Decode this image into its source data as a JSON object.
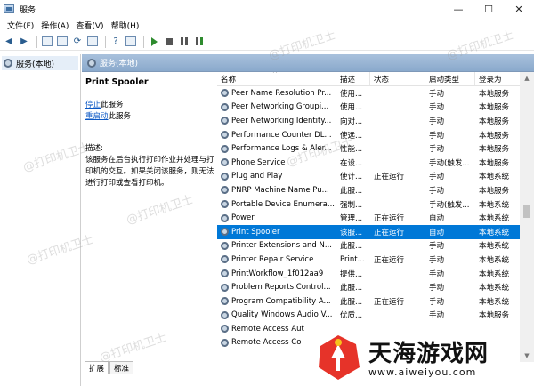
{
  "window": {
    "title": "服务",
    "controls": [
      "—",
      "☐",
      "✕"
    ]
  },
  "menu": [
    "文件(F)",
    "操作(A)",
    "查看(V)",
    "帮助(H)"
  ],
  "tree": {
    "root_label": "服务(本地)"
  },
  "pane": {
    "header": "服务(本地)"
  },
  "details": {
    "service_name": "Print Spooler",
    "stop_link": "停止",
    "stop_suffix": "此服务",
    "restart_link": "重启动",
    "restart_suffix": "此服务",
    "desc_label": "描述:",
    "desc_text": "该服务在后台执行打印作业并处理与打印机的交互。如果关闭该服务，则无法进行打印或查看打印机。"
  },
  "columns": {
    "name": "名称",
    "desc": "描述",
    "status": "状态",
    "startup": "启动类型",
    "login": "登录为"
  },
  "rows": [
    {
      "name": "Peer Name Resolution Pr...",
      "desc": "使用...",
      "status": "",
      "startup": "手动",
      "login": "本地服务"
    },
    {
      "name": "Peer Networking Groupi...",
      "desc": "使用...",
      "status": "",
      "startup": "手动",
      "login": "本地服务"
    },
    {
      "name": "Peer Networking Identity...",
      "desc": "向对...",
      "status": "",
      "startup": "手动",
      "login": "本地服务"
    },
    {
      "name": "Performance Counter DL...",
      "desc": "使远...",
      "status": "",
      "startup": "手动",
      "login": "本地服务"
    },
    {
      "name": "Performance Logs & Aler...",
      "desc": "性能...",
      "status": "",
      "startup": "手动",
      "login": "本地服务"
    },
    {
      "name": "Phone Service",
      "desc": "在设...",
      "status": "",
      "startup": "手动(触发...",
      "login": "本地服务"
    },
    {
      "name": "Plug and Play",
      "desc": "使计...",
      "status": "正在运行",
      "startup": "手动",
      "login": "本地系统"
    },
    {
      "name": "PNRP Machine Name Pu...",
      "desc": "此服...",
      "status": "",
      "startup": "手动",
      "login": "本地服务"
    },
    {
      "name": "Portable Device Enumera...",
      "desc": "强制...",
      "status": "",
      "startup": "手动(触发...",
      "login": "本地系统"
    },
    {
      "name": "Power",
      "desc": "管理...",
      "status": "正在运行",
      "startup": "自动",
      "login": "本地系统"
    },
    {
      "name": "Print Spooler",
      "desc": "该服...",
      "status": "正在运行",
      "startup": "自动",
      "login": "本地系统",
      "selected": true
    },
    {
      "name": "Printer Extensions and N...",
      "desc": "此服...",
      "status": "",
      "startup": "手动",
      "login": "本地系统"
    },
    {
      "name": "Printer Repair Service",
      "desc": "Print...",
      "status": "正在运行",
      "startup": "手动",
      "login": "本地系统"
    },
    {
      "name": "PrintWorkflow_1f012aa9",
      "desc": "提供...",
      "status": "",
      "startup": "手动",
      "login": "本地系统"
    },
    {
      "name": "Problem Reports Control...",
      "desc": "此服...",
      "status": "",
      "startup": "手动",
      "login": "本地系统"
    },
    {
      "name": "Program Compatibility A...",
      "desc": "此服...",
      "status": "正在运行",
      "startup": "手动",
      "login": "本地系统"
    },
    {
      "name": "Quality Windows Audio V...",
      "desc": "优质...",
      "status": "",
      "startup": "手动",
      "login": "本地服务"
    },
    {
      "name": "Remote Access Aut",
      "desc": "",
      "status": "",
      "startup": "",
      "login": ""
    },
    {
      "name": "Remote Access Co",
      "desc": "",
      "status": "",
      "startup": "",
      "login": ""
    }
  ],
  "tabs": [
    "扩展",
    "标准"
  ],
  "watermark": "@打印机卫士",
  "brand": {
    "name": "天海游戏网",
    "url": "www.aiweiyou.com"
  }
}
